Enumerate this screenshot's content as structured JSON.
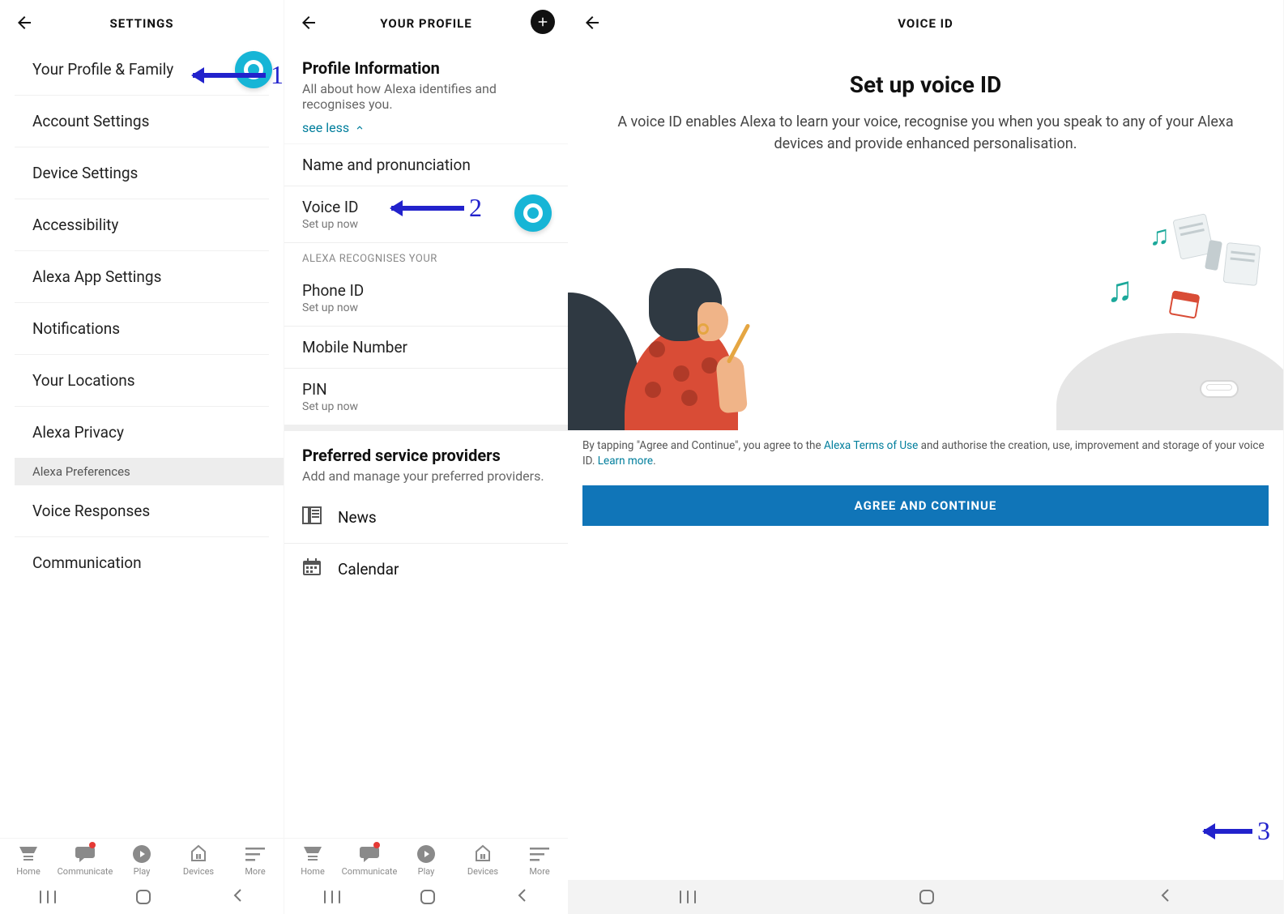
{
  "annotations": {
    "step1": "1",
    "step2": "2",
    "step3": "3"
  },
  "screen1": {
    "header": "SETTINGS",
    "items": [
      "Your Profile & Family",
      "Account Settings",
      "Device Settings",
      "Accessibility",
      "Alexa App Settings",
      "Notifications",
      "Your Locations",
      "Alexa Privacy"
    ],
    "sectionHeader": "Alexa Preferences",
    "prefs": [
      "Voice Responses",
      "Communication"
    ]
  },
  "screen2": {
    "header": "YOUR PROFILE",
    "profileInfoTitle": "Profile Information",
    "profileInfoSub": "All about how Alexa identifies and recognises you.",
    "seeLess": "see less",
    "namePron": "Name and pronunciation",
    "voiceId": {
      "title": "Voice ID",
      "sub": "Set up now"
    },
    "recognisesHeader": "ALEXA RECOGNISES YOUR",
    "phoneId": {
      "title": "Phone ID",
      "sub": "Set up now"
    },
    "mobileNumber": "Mobile Number",
    "pin": {
      "title": "PIN",
      "sub": "Set up now"
    },
    "providersTitle": "Preferred service providers",
    "providersSub": "Add and manage your preferred providers.",
    "news": "News",
    "calendar": "Calendar"
  },
  "screen3": {
    "header": "VOICE ID",
    "title": "Set up voice ID",
    "desc": "A voice ID enables Alexa to learn your voice, recognise you when you speak to any of your Alexa devices and provide enhanced personalisation.",
    "legalPrefix": "By tapping \"Agree and Continue\", you agree to the ",
    "termsLink": "Alexa Terms of Use",
    "legalMid": " and authorise the creation, use, improvement and storage of your voice ID. ",
    "learnMore": "Learn more",
    "button": "AGREE AND CONTINUE"
  },
  "bottomNav": {
    "home": "Home",
    "communicate": "Communicate",
    "play": "Play",
    "devices": "Devices",
    "more": "More"
  }
}
